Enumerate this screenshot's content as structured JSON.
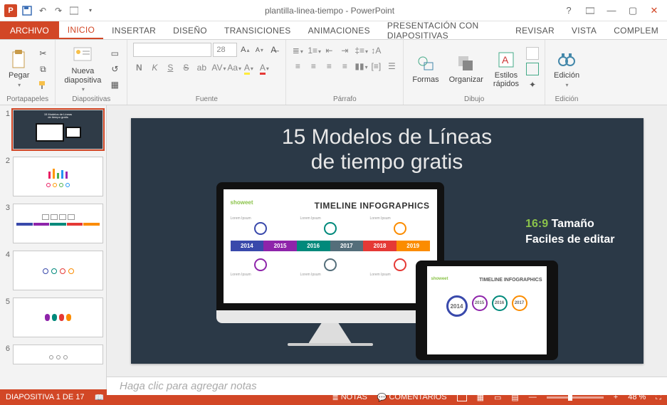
{
  "app": {
    "title": "plantilla-linea-tiempo - PowerPoint"
  },
  "tabs": {
    "file": "ARCHIVO",
    "items": [
      "INICIO",
      "INSERTAR",
      "DISEÑO",
      "TRANSICIONES",
      "ANIMACIONES",
      "PRESENTACIÓN CON DIAPOSITIVAS",
      "REVISAR",
      "VISTA",
      "COMPLEM"
    ],
    "active": 0
  },
  "ribbon": {
    "clipboard": {
      "label": "Portapapeles",
      "paste": "Pegar"
    },
    "slides": {
      "label": "Diapositivas",
      "new_slide": "Nueva\ndiapositiva"
    },
    "font": {
      "label": "Fuente",
      "size": "28",
      "family": ""
    },
    "paragraph": {
      "label": "Párrafo"
    },
    "drawing": {
      "label": "Dibujo",
      "shapes": "Formas",
      "arrange": "Organizar",
      "quick": "Estilos\nrápidos"
    },
    "editing": {
      "label": "Edición",
      "btn": "Edición"
    }
  },
  "thumbs": {
    "count": 6,
    "selected": 1
  },
  "slide": {
    "title_l1": "15 Modelos de Líneas",
    "title_l2": "de tiempo gratis",
    "brand": "showeet",
    "infographic_title": "TIMELINE INFOGRAPHICS",
    "lorem": "Lorem Ipsum",
    "years": [
      "2014",
      "2015",
      "2016",
      "2017",
      "2018",
      "2019"
    ],
    "year_colors": [
      "#3949ab",
      "#8e24aa",
      "#00897b",
      "#546e7a",
      "#e53935",
      "#fb8c00"
    ],
    "ipad_years": [
      "2014",
      "2015",
      "2016",
      "2017"
    ],
    "ratio": "16:9",
    "ratio_label": "Tamaño",
    "easy": "Faciles de editar"
  },
  "notes": {
    "placeholder": "Haga clic para agregar notas"
  },
  "status": {
    "slide_of": "DIAPOSITIVA 1 DE 17",
    "lang": "",
    "notes": "NOTAS",
    "comments": "COMENTARIOS",
    "zoom": "48 %"
  }
}
